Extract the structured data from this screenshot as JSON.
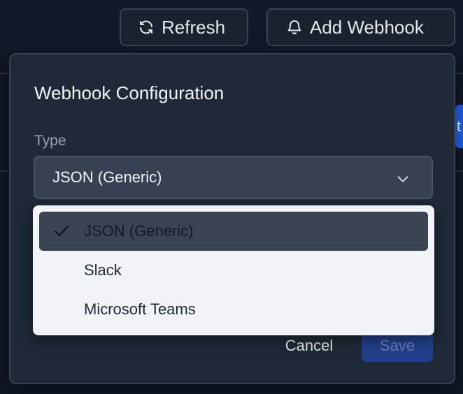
{
  "toolbar": {
    "refresh_label": "Refresh",
    "add_webhook_label": "Add Webhook",
    "partial_button_text": "t"
  },
  "dialog": {
    "title": "Webhook Configuration",
    "type_label": "Type",
    "type_value": "JSON (Generic)",
    "cancel_label": "Cancel",
    "save_label": "Save"
  },
  "dropdown": {
    "options": [
      {
        "label": "JSON (Generic)",
        "selected": true
      },
      {
        "label": "Slack",
        "selected": false
      },
      {
        "label": "Microsoft Teams",
        "selected": false
      }
    ]
  },
  "icons": {
    "refresh": "refresh-icon",
    "bell": "bell-icon",
    "chevron": "chevron-down-icon",
    "check": "check-icon"
  },
  "colors": {
    "background": "#111827",
    "panel": "#1f2937",
    "accent": "#2563eb",
    "save_disabled": "#223f8a",
    "dropdown_bg": "#f1f3f6",
    "selected_option_bg": "#3b4453"
  }
}
